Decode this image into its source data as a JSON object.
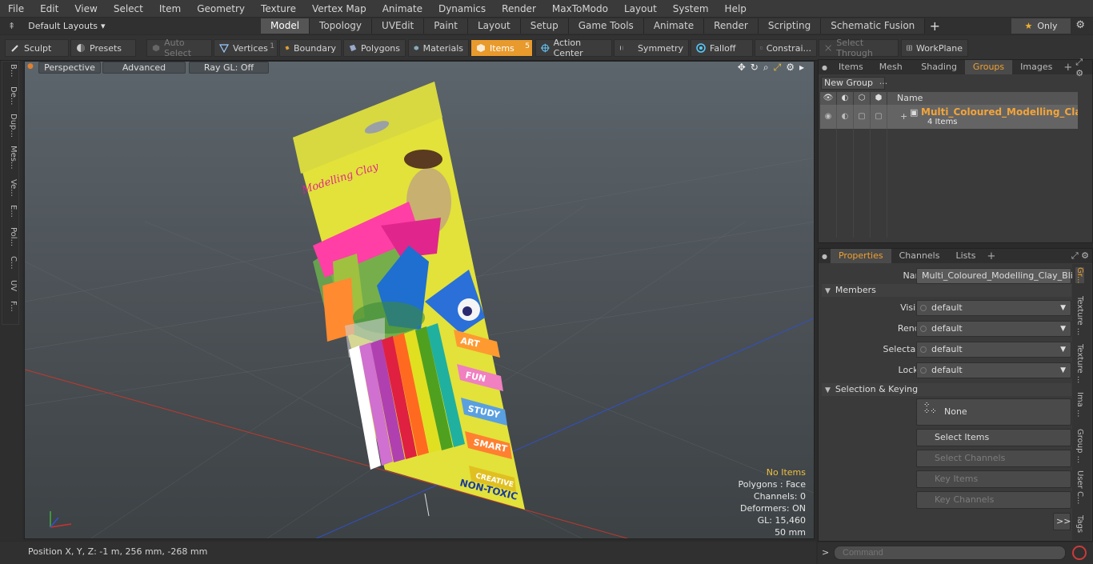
{
  "menu": [
    "File",
    "Edit",
    "View",
    "Select",
    "Item",
    "Geometry",
    "Texture",
    "Vertex Map",
    "Animate",
    "Dynamics",
    "Render",
    "MaxToModo",
    "Layout",
    "System",
    "Help"
  ],
  "layout": {
    "dropdown": "Default Layouts",
    "tabs": [
      "Model",
      "Topology",
      "UVEdit",
      "Paint",
      "Layout",
      "Setup",
      "Game Tools",
      "Animate",
      "Render",
      "Scripting",
      "Schematic Fusion"
    ],
    "active_tab": "Model",
    "only_label": "Only"
  },
  "toolbar": {
    "sculpt": "Sculpt",
    "presets": "Presets",
    "auto_select": "Auto Select",
    "vertices": "Vertices",
    "vertices_count": "1",
    "boundary": "Boundary",
    "polygons": "Polygons",
    "materials": "Materials",
    "items": "Items",
    "items_count": "5",
    "action_center": "Action Center",
    "symmetry": "Symmetry",
    "falloff": "Falloff",
    "constrain": "Constrai...",
    "select_through": "Select Through",
    "workplane": "WorkPlane"
  },
  "left_tabs": [
    "B...",
    "De...",
    "Dup...",
    "Mes...",
    "Ve...",
    "E...",
    "Pol...",
    "C...",
    "UV",
    "F..."
  ],
  "viewport": {
    "perspective": "Perspective",
    "advanced": "Advanced",
    "raygl": "Ray GL: Off",
    "stats": {
      "no_items": "No Items",
      "polygons": "Polygons : Face",
      "channels": "Channels: 0",
      "deformers": "Deformers: ON",
      "gl": "GL: 15,460",
      "scale": "50 mm"
    },
    "product": {
      "brand": "Modelling Clay",
      "tags": [
        "ART",
        "FUN",
        "STUDY",
        "SMART",
        "CREATIVE"
      ],
      "footer": "NON-TOXIC"
    }
  },
  "status": {
    "position": "Position X, Y, Z:  -1 m, 256 mm, -268 mm"
  },
  "top_panel": {
    "tabs": [
      "Items",
      "Mesh ...",
      "Shading",
      "Groups",
      "Images"
    ],
    "active_tab": "Groups",
    "new_group": "New Group",
    "name_col": "Name",
    "group_name": "Multi_Coloured_Modelling_Clay ...",
    "group_count": "4 Items"
  },
  "properties": {
    "tabs": [
      "Properties",
      "Channels",
      "Lists"
    ],
    "active_tab": "Properties",
    "name_label": "Name",
    "name_value": "Multi_Coloured_Modelling_Clay_Blister",
    "members": "Members",
    "visible_label": "Visible",
    "visible_value": "default",
    "render_label": "Render",
    "render_value": "default",
    "selectable_label": "Selectable",
    "selectable_value": "default",
    "locked_label": "Locked",
    "locked_value": "default",
    "selection_keying": "Selection & Keying",
    "none_label": "None",
    "select_items": "Select Items",
    "select_channels": "Select Channels",
    "key_items": "Key Items",
    "key_channels": "Key Channels",
    "more": ">>",
    "side_tabs": [
      "Gr...",
      "Texture ...",
      "Texture ...",
      "Ima ...",
      "Group ...",
      "User C...",
      "Tags"
    ]
  },
  "command": {
    "placeholder": "Command"
  }
}
